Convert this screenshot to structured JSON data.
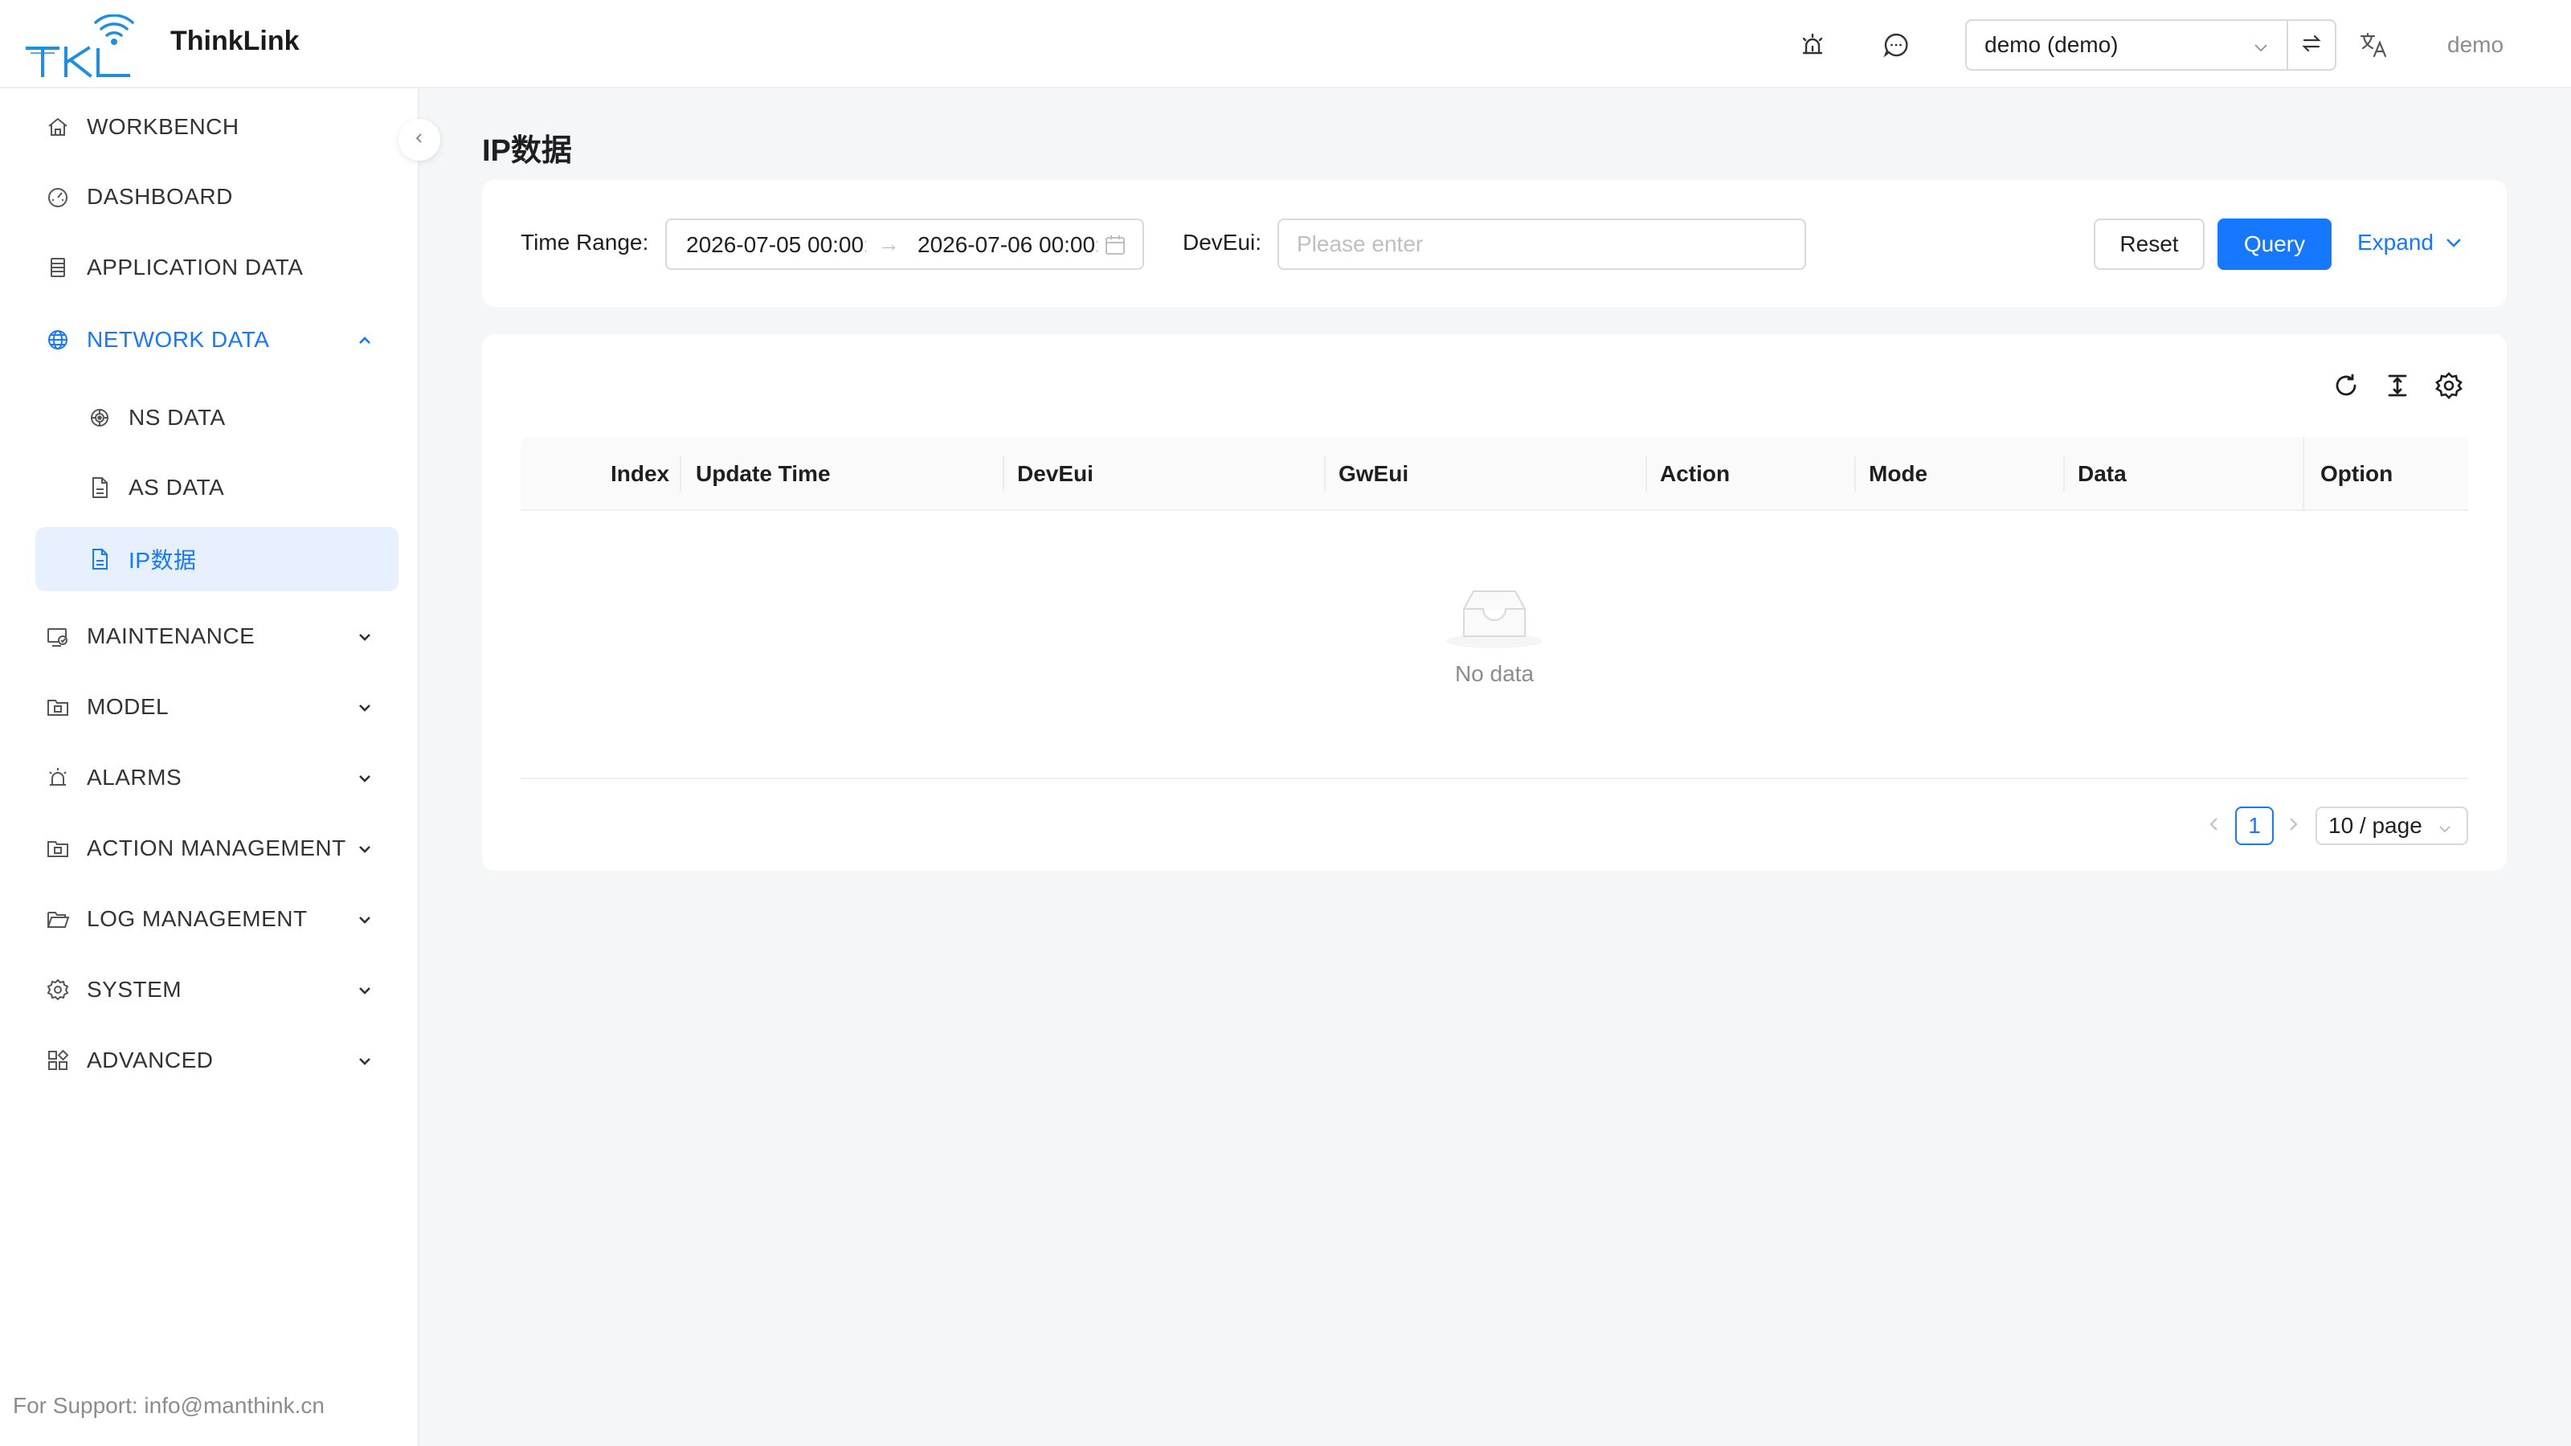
{
  "header": {
    "app_title": "ThinkLink",
    "logo_text": "TKL",
    "tenant_select": "demo (demo)",
    "user": "demo",
    "icons": [
      "alarm-icon",
      "chat-icon",
      "swap-icon",
      "translate-icon"
    ]
  },
  "sidebar": {
    "items": [
      {
        "label": "WORKBENCH",
        "icon": "home-icon"
      },
      {
        "label": "DASHBOARD",
        "icon": "dashboard-icon"
      },
      {
        "label": "APPLICATION DATA",
        "icon": "table-icon"
      },
      {
        "label": "NETWORK DATA",
        "icon": "globe-icon",
        "expanded": true
      },
      {
        "label": "NS DATA",
        "icon": "radar-icon",
        "submenu": true
      },
      {
        "label": "AS DATA",
        "icon": "file-icon",
        "submenu": true
      },
      {
        "label": "IP数据",
        "icon": "file-icon",
        "submenu": true,
        "active": true
      },
      {
        "label": "MAINTENANCE",
        "icon": "maintenance-icon"
      },
      {
        "label": "MODEL",
        "icon": "folder-icon"
      },
      {
        "label": "ALARMS",
        "icon": "alarm-icon"
      },
      {
        "label": "ACTION MANAGEMENT",
        "icon": "folder-icon"
      },
      {
        "label": "LOG MANAGEMENT",
        "icon": "folder-open-icon"
      },
      {
        "label": "SYSTEM",
        "icon": "gear-icon"
      },
      {
        "label": "ADVANCED",
        "icon": "apps-icon"
      }
    ],
    "support": "For Support: info@manthink.cn"
  },
  "page": {
    "title": "IP数据"
  },
  "search": {
    "time_range_label": "Time Range",
    "time_start": "2026-07-05 00:00:00",
    "time_end": "2026-07-06 00:00:00",
    "deveui_label": "DevEui",
    "deveui_placeholder": "Please enter",
    "deveui_value": "",
    "reset_label": "Reset",
    "query_label": "Query",
    "expand_label": "Expand"
  },
  "table": {
    "columns": [
      "Index",
      "Update Time",
      "DevEui",
      "GwEui",
      "Action",
      "Mode",
      "Data",
      "Option"
    ],
    "rows": [],
    "empty_text": "No data",
    "toolbar_icons": [
      "reload-icon",
      "density-icon",
      "settings-icon"
    ]
  },
  "pagination": {
    "current_page": "1",
    "page_size": "10 / page"
  },
  "colors": {
    "accent": "#1677ff",
    "active_bg": "#e6f0ff",
    "muted_text": "#8c8c8c"
  }
}
